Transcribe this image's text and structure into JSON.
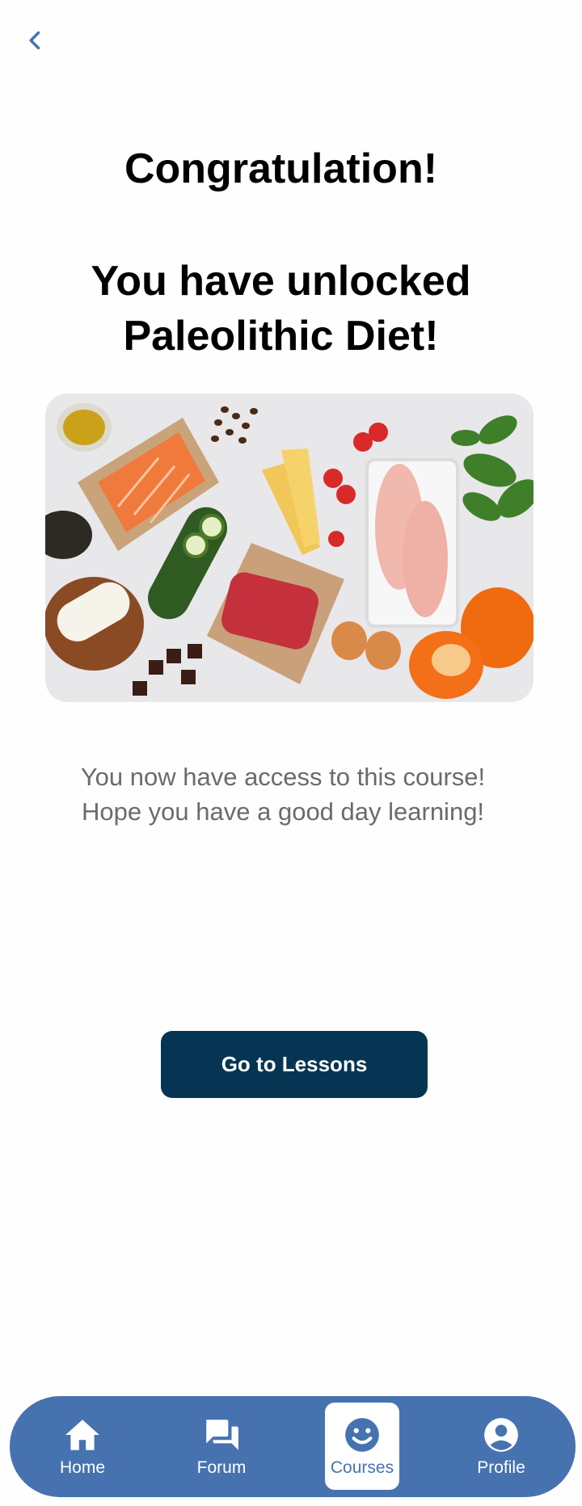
{
  "header": {
    "back_icon": "chevron-left-icon"
  },
  "heading": {
    "title": "Congratulation!",
    "subtitle_line1": "You have unlocked",
    "subtitle_line2": "Paleolithic Diet!"
  },
  "hero": {
    "alt": "Paleo diet foods: salmon, avocado, cheese, zucchini, ground beef, strawberries, chicken breasts, eggs, spinach, peppers, chocolate, coffee beans, olive oil"
  },
  "message": {
    "line1": "You now have access to this course!",
    "line2": "Hope you have a good day learning!"
  },
  "cta": {
    "label": "Go to Lessons"
  },
  "tabbar": {
    "items": [
      {
        "label": "Home",
        "icon": "home-icon",
        "active": false
      },
      {
        "label": "Forum",
        "icon": "forum-icon",
        "active": false
      },
      {
        "label": "Courses",
        "icon": "courses-icon",
        "active": true
      },
      {
        "label": "Profile",
        "icon": "profile-icon",
        "active": false
      }
    ]
  },
  "colors": {
    "primary_dark": "#053553",
    "accent_blue": "#4673b0",
    "muted_text": "#6b6b6b"
  }
}
